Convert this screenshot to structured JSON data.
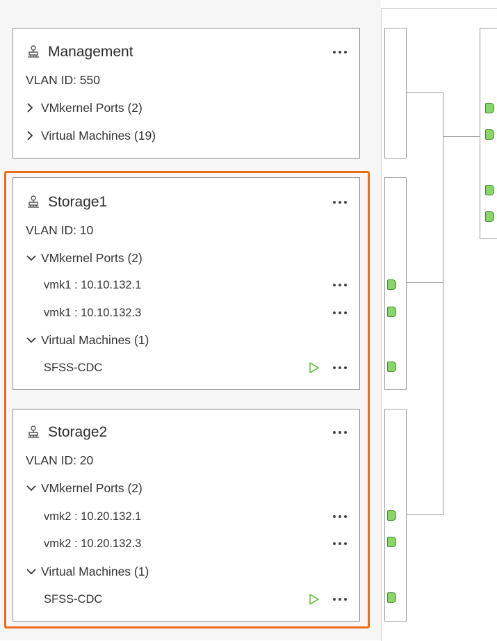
{
  "colors": {
    "highlight": "#ec6b15",
    "port_fill": "#8bd36b",
    "port_border": "#3e8a2c",
    "play": "#6cc04a"
  },
  "port_groups": [
    {
      "name": "Management",
      "vlan": "VLAN ID: 550",
      "vmkernel_header": "VMkernel Ports (2)",
      "vm_header": "Virtual Machines (19)"
    },
    {
      "name": "Storage1",
      "vlan": "VLAN ID: 10",
      "vmkernel_header": "VMkernel Ports (2)",
      "vmkernels": [
        "vmk1 : 10.10.132.1",
        "vmk1 : 10.10.132.3"
      ],
      "vm_header": "Virtual Machines (1)",
      "vms": [
        "SFSS-CDC"
      ]
    },
    {
      "name": "Storage2",
      "vlan": "VLAN ID: 20",
      "vmkernel_header": "VMkernel Ports (2)",
      "vmkernels": [
        "vmk2 : 10.20.132.1",
        "vmk2 : 10.20.132.3"
      ],
      "vm_header": "Virtual Machines (1)",
      "vms": [
        "SFSS-CDC"
      ]
    }
  ]
}
